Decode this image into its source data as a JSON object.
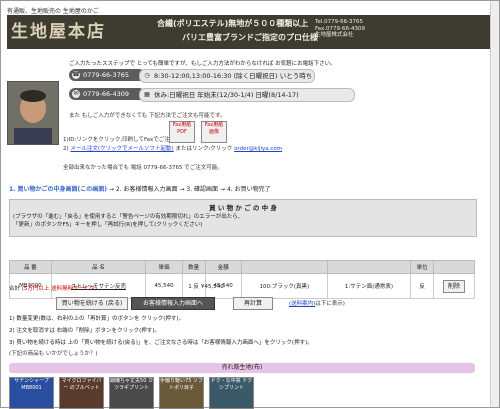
{
  "header": {
    "tagline": "有通販、生地販売の 生地屋のかご",
    "logo": "生地屋本店",
    "headline1": "合繊(ポリエステル)無地が５００種類以上",
    "headline2": "バリエ豊富ブランドご指定のプロ仕様",
    "contact": [
      "Tel.0779-66-3765",
      "Fax.0779-66-4309",
      "生地屋株式会社"
    ]
  },
  "intro": {
    "text": "ご入力たったスステップで とっても簡単ですが、もしご入力方法がわからなければ お気軽にお電話下さい。",
    "tel_pill": "0779-66-3765",
    "hours_pill": "8:30-12:00,13:00-16:30 (除く日曜祝日) いとう時ち",
    "fax_pill": "0779-66-4309",
    "holiday_pill": "休み:日曜祝日 年始末(12/30-1/4) 日曜(8/14-17)",
    "also_text": "また もしご入力ができなくても 下記方法でご注文も可能です。",
    "option1": "1)ID:リンクをクリック,印刷してFaxでご注文",
    "option2_link": "メール注文(クリックでメールソフト起動)",
    "option2_mid": "またはリンク:クリック",
    "email": "order@kijiya.com",
    "fax_buttons": [
      "Fax用紙 PDF",
      "Fax用紙 画像"
    ],
    "phone_note": "全部出来なかった場合でも 電話 0779-66-3765 でご注文可能。"
  },
  "steps": [
    {
      "label": "1. 買い物かごの中身画面(この画面)",
      "active": true
    },
    {
      "label": "→",
      "active": false
    },
    {
      "label": "2. お客様情報入力画面",
      "active": false
    },
    {
      "label": "→",
      "active": false
    },
    {
      "label": "3. 確認画面",
      "active": false
    },
    {
      "label": "→",
      "active": false
    },
    {
      "label": "4. お買い物完了",
      "active": false
    }
  ],
  "cart_notice": {
    "title": "買 い 物 か ご の 中 身",
    "line1": "(ブラウザの「進む」「戻る」を使用すると「警告ページの有効期限切れ」のエラーが出たら、",
    "line2": "「更新」のボタンかF5」キーを押し「再試行(R)を押して(クリックください)"
  },
  "table": {
    "headers": [
      "品 番",
      "品 名",
      "単価",
      "数量",
      "金額",
      "",
      "",
      "単位",
      ""
    ],
    "row": [
      "MB3000",
      "ストレッチサテン反売",
      "45,540",
      "1 反",
      "45,540",
      "100:ブラック(真黒)",
      "1:サテン面(通常表)",
      "反",
      "削除"
    ],
    "total_label": "合計",
    "total_note": "(5万円以上 送料無料サービス)",
    "total_value": "¥45,540"
  },
  "buttons": {
    "continue": "買い物を続ける (戻る)",
    "customer": "お客様情報入力画面へ",
    "recalc": "再計算",
    "shipping_link": "(送料案内)",
    "shipping_tail": "は下に表示)"
  },
  "notes": [
    "1) 数量変更(数は、右利の上の「再計算」のボタンを クリック(押す)。",
    "2) 注文を取消すは 右端の「削除」ボタンをクリック(押す)。",
    "3) 買い物を続ける時は 上の「買い物を続ける(戻る)」を、ご注文なさる時は「お客様情報入力画面へ」をクリック(押す)。"
  ],
  "other_note": "(下記の商品も いかがでしょうか？)",
  "ranking_title": "売れ筋生地(布)",
  "thumbs": [
    "サテンシャープ MB8001",
    "マイクロファイバー のブルベット",
    "細織ちゃ丈夫50 カツラギプリント",
    "手触り軽い75 ソフトポリ目子",
    "ドク・な中高 ドクシプリント"
  ],
  "colors": {
    "header_bg": "#3e3b30",
    "step_active": "#3366cc",
    "ranking": "#e6c4e6"
  }
}
